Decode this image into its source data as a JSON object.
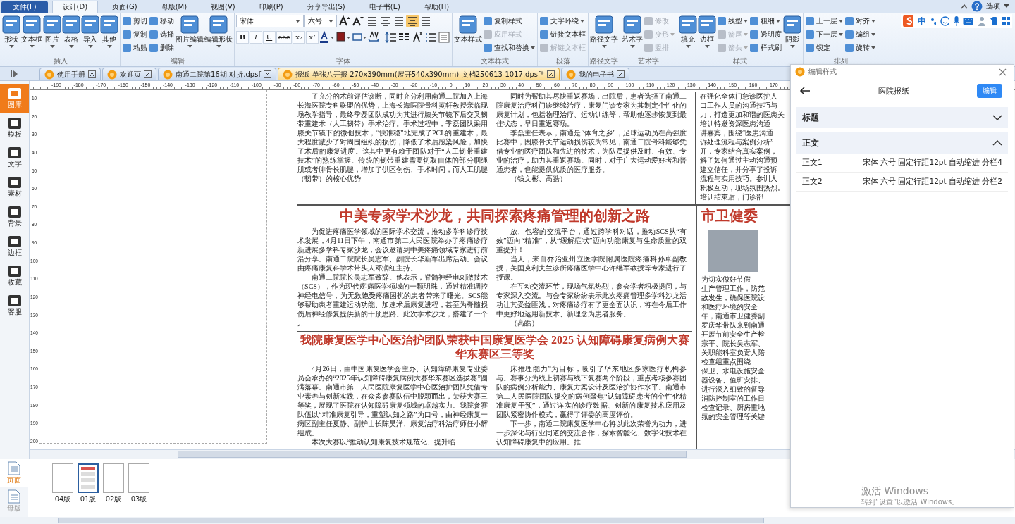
{
  "menu": {
    "tabs": [
      {
        "label": "文件(F)",
        "kind": "file",
        "selected": false
      },
      {
        "label": "设计(D)",
        "kind": "tab",
        "selected": true
      },
      {
        "label": "页面(G)",
        "kind": "tab",
        "selected": false
      },
      {
        "label": "母版(M)",
        "kind": "tab",
        "selected": false
      },
      {
        "label": "视图(V)",
        "kind": "tab",
        "selected": false
      },
      {
        "label": "印刷(P)",
        "kind": "tab",
        "selected": false
      },
      {
        "label": "分享导出(S)",
        "kind": "tab",
        "selected": false
      },
      {
        "label": "电子书(E)",
        "kind": "tab",
        "selected": false
      },
      {
        "label": "帮助(H)",
        "kind": "tab",
        "selected": false
      }
    ],
    "options": "选项"
  },
  "ime": {
    "label": "中"
  },
  "ribbon": {
    "groups": [
      {
        "label": "插入",
        "items": [
          {
            "kind": "large",
            "label": "形状",
            "menu": true
          },
          {
            "kind": "large",
            "label": "文本框",
            "menu": true
          },
          {
            "kind": "large",
            "label": "图片",
            "menu": true
          },
          {
            "kind": "large",
            "label": "表格",
            "menu": true
          },
          {
            "kind": "large",
            "label": "导入",
            "menu": true
          },
          {
            "kind": "large",
            "label": "其他",
            "menu": true
          }
        ]
      },
      {
        "label": "编辑",
        "items": [
          {
            "kind": "stack",
            "items": [
              {
                "label": "剪切",
                "disabled": false,
                "menu": false
              },
              {
                "label": "复制",
                "disabled": false,
                "menu": false
              },
              {
                "label": "粘贴",
                "disabled": false,
                "menu": false
              }
            ]
          },
          {
            "kind": "stack",
            "items": [
              {
                "label": "移动",
                "disabled": false,
                "menu": false
              },
              {
                "label": "选择",
                "disabled": false,
                "menu": false
              },
              {
                "label": "删除",
                "disabled": false,
                "menu": false
              }
            ]
          },
          {
            "kind": "large",
            "label": "图片编辑",
            "menu": true
          },
          {
            "kind": "large",
            "label": "编辑形状",
            "menu": true
          }
        ]
      },
      {
        "label": "字体",
        "items": [
          {
            "kind": "font",
            "font": "宋体",
            "size": "六号",
            "alignment": [
              {
                "selected": false
              },
              {
                "selected": false
              },
              {
                "selected": false
              },
              {
                "selected": true
              },
              {
                "selected": false
              }
            ],
            "text_buttons": [
              "B",
              "I",
              "U",
              "abc",
              "x₂",
              "x²"
            ]
          }
        ]
      },
      {
        "label": "文本样式",
        "items": [
          {
            "kind": "large",
            "label": "文本样式",
            "menu": false
          },
          {
            "kind": "stack",
            "items": [
              {
                "label": "复制样式",
                "disabled": false,
                "menu": false
              },
              {
                "label": "应用样式",
                "disabled": true,
                "menu": false
              },
              {
                "label": "查找和替换",
                "disabled": false,
                "menu": true
              }
            ]
          }
        ]
      },
      {
        "label": "段落",
        "items": [
          {
            "kind": "stack",
            "items": [
              {
                "label": "文字环绕",
                "disabled": false,
                "menu": true
              },
              {
                "label": "链接文本框",
                "disabled": false,
                "menu": false
              },
              {
                "label": "解链文本框",
                "disabled": true,
                "menu": false
              }
            ]
          }
        ]
      },
      {
        "label": "路径文字",
        "items": [
          {
            "kind": "large",
            "label": "路径文字",
            "menu": true
          }
        ]
      },
      {
        "label": "艺术字",
        "items": [
          {
            "kind": "large",
            "label": "艺术字",
            "menu": true
          },
          {
            "kind": "stack",
            "items": [
              {
                "label": "修改",
                "disabled": true,
                "menu": false
              },
              {
                "label": "变形",
                "disabled": true,
                "menu": true
              },
              {
                "label": "竖排",
                "disabled": true,
                "menu": false
              }
            ]
          }
        ]
      },
      {
        "label": "样式",
        "items": [
          {
            "kind": "large",
            "label": "填充",
            "menu": true
          },
          {
            "kind": "large",
            "label": "边框",
            "menu": true
          },
          {
            "kind": "stack",
            "items": [
              {
                "label": "线型",
                "disabled": false,
                "menu": true
              },
              {
                "label": "箭尾",
                "disabled": true,
                "menu": true
              },
              {
                "label": "箭头",
                "disabled": true,
                "menu": true
              }
            ]
          },
          {
            "kind": "stack",
            "items": [
              {
                "label": "粗细",
                "disabled": false,
                "menu": true
              },
              {
                "label": "透明度",
                "disabled": false,
                "menu": false
              },
              {
                "label": "样式刷",
                "disabled": false,
                "menu": false
              }
            ]
          },
          {
            "kind": "large",
            "label": "阴影",
            "menu": true
          }
        ]
      },
      {
        "label": "排列",
        "items": [
          {
            "kind": "stack",
            "items": [
              {
                "label": "上一层",
                "disabled": false,
                "menu": true
              },
              {
                "label": "下一层",
                "disabled": false,
                "menu": true
              },
              {
                "label": "锁定",
                "disabled": false,
                "menu": false
              }
            ]
          },
          {
            "kind": "stack",
            "items": [
              {
                "label": "对齐",
                "disabled": false,
                "menu": true
              },
              {
                "label": "编组",
                "disabled": false,
                "menu": true
              },
              {
                "label": "旋转",
                "disabled": false,
                "menu": true
              }
            ]
          }
        ]
      }
    ]
  },
  "document_tabs": [
    {
      "label": "使用手册",
      "selected": false
    },
    {
      "label": "欢迎页",
      "selected": false
    },
    {
      "label": "南通二院第16期-对折.dpsf",
      "selected": false
    },
    {
      "label": "报纸-单张八开报-270x390mm(展开540x390mm)-文档250613-1017.dpsf*",
      "selected": true
    },
    {
      "label": "我的电子书",
      "selected": false
    }
  ],
  "sidebar": {
    "items": [
      {
        "label": "图库",
        "selected": true
      },
      {
        "label": "模板",
        "selected": false
      },
      {
        "label": "文字",
        "selected": false
      },
      {
        "label": "素材",
        "selected": false
      },
      {
        "label": "背景",
        "selected": false
      },
      {
        "label": "边框",
        "selected": false
      },
      {
        "label": "收藏",
        "selected": false
      },
      {
        "label": "客服",
        "selected": false
      }
    ]
  },
  "ruler": {
    "horizontal": [
      "-190",
      "-180",
      "-170",
      "-160",
      "-150",
      "-140",
      "-130",
      "-120",
      "-110",
      "-100",
      "-90",
      "-80",
      "-70",
      "-60",
      "-50",
      "-40",
      "-30",
      "-20",
      "-10",
      "0",
      "10",
      "20",
      "30",
      "40",
      "50",
      "60",
      "70",
      "80",
      "90",
      "100",
      "110",
      "120",
      "130",
      "140",
      "150",
      "160",
      "170"
    ],
    "vertical": [
      "10",
      "20",
      "30",
      "40",
      "50",
      "60",
      "70",
      "80",
      "90",
      "100",
      "110",
      "120",
      "130",
      "140",
      "150",
      "160",
      "170",
      "180",
      "190",
      "200"
    ]
  },
  "newspaper": {
    "top_columns": [
      {
        "paragraphs": [
          "了充分的术前评估诊断，同时充分利用南通二院加入上海长海医院专科联盟的优势，上海长海医院骨科黄轩教授亲临现场教学指导，最终季磊团队成功为其进行膝关节镜下后交叉韧带重建术（人工韧带）手术治疗。手术过程中，季磊团队采用膝关节镜下的微创技术，“快准稳”地完成了PCL的重建术，最大程度减少了对周围组织的损伤，降低了术后感染风险，加快了术后的康复进度。这其中更有赖于团队对于“人工韧带重建技术”的熟练掌握。传统的韧带重建需要切取自体的部分腘绳肌或者腓骨长肌腱，增加了供区创伤、手术时间，而人工肌腱（韧带）的核心优势"
        ]
      },
      {
        "paragraphs": [
          "同时为帮助其尽快重返赛场，出院后，患者选择了南通二院康复治疗科门诊继续治疗，康复门诊专家为其制定个性化的康复计划，包括物理治疗、运动训练等，帮助他逐步恢复到最佳状态，早日重返赛场。",
          "季磊主任表示，南通是“体育之乡”，足球运动员在高强度比赛中，因膝骨关节运动损伤较为常见，南通二院骨科能够凭借专业的医疗团队和先进的技术，为队员提供及时、有效、专业的治疗，助力其重返赛场。同时，对于广大运动爱好者和普通患者，也能提供优质的医疗服务。",
          "（钱文彬、高皓）"
        ]
      }
    ],
    "top_right_lines": [
      "在强化全体门急诊医护人",
      "口工作人员的沟通技巧与",
      "力，打造更加和谐的医患关",
      "培训特邀资深医患沟通",
      "讲嘉宾，围绕“医患沟通",
      "诉处理流程与案例分析”",
      "开，专家结合真实案例，",
      "解了如何通过主动沟通预",
      "建立信任，并分享了投诉",
      "流程与实用技巧。参训人",
      "积极互动，现场氛围热烈。",
      "培训结束后，门诊部"
    ],
    "articles": [
      {
        "headline": "中美专家学术沙龙，共同探索疼痛管理的创新之路",
        "columns": [
          {
            "paragraphs": [
              "为促进疼痛医学领域的国际学术交流，推动多学科诊疗技术发展，4月11日下午，南通市第二人民医院举办了疼痛诊疗新进展多学科专家沙龙，会议邀请到中美疼痛领域专家进行前沿分享。南通二院院长吴志军、副院长华新军出席活动。会议由疼痛康复科学术带头人邓润红主持。",
              "南通二院院长吴志军致辞。他表示，脊髓神经电刺激技术（SCS），作为现代疼痛医学领域的一颗明珠，通过精准调控神经电信号，为无数饱受疼痛困扰的患者带来了曙光。SCS能够帮助患者重建运动功能、加速术后康复进程，甚至为脊髓损伤后神经修复提供新的干预思路。此次学术沙龙，搭建了一个开"
            ]
          },
          {
            "paragraphs": [
              "放、包容的交流平台，通过跨学科对话，推动SCS从“有效”迈向“精准”，从“缓解症状”迈向功能康复与生命质量的双重提升！",
              "当天，来自乔治亚州立医学院附属医院疼痛科孙卓副教授，美国克利夫兰诊所疼痛医学中心许继军教授等专家进行了授课。",
              "在互动交流环节，现场气氛热烈，参会学者积极提问，与专家深入交流。与会专家纷纷表示此次疼痛管理多学科沙龙活动让其受益匪浅，对疼痛诊疗有了更全面认识，将在今后工作中更好地运用新技术、新理念为患者服务。",
              "（高皓）"
            ]
          }
        ]
      },
      {
        "headline": "我院康复医学中心医治护团队荣获中国康复医学会 2025 认知障碍康复病例大赛华东赛区三等奖",
        "columns": [
          {
            "paragraphs": [
              "4月26日，由中国康复医学会主办、认知障碍康复专业委员会承办的“2025年认知障碍康复病例大赛华东赛区选拔赛”圆满落幕。南通市第二人民医院康复医学中心医治护团队凭借专业素养与创新实践，在众多参赛队伍中脱颖而出，荣获大赛三等奖，展现了医院在认知障碍康复领域的卓越实力。我院参赛队伍以“精准康复引导，重塑认知之路”为口号，由神经康复一病区副主任夏静、副护士长陈昊洋、康复治疗科治疗师任小辉组成。",
              "本次大赛以“推动认知康复技术规范化、提升临"
            ]
          },
          {
            "paragraphs": [
              "床推理能力”为目标，吸引了华东地区多家医疗机构参与。赛事分为线上初赛与线下复赛两个阶段，重点考核参赛团队的病例分析能力、康复方案设计及医治护协作水平。南通市第二人民医院团队提交的病例聚焦“认知障碍患者的个性化精准康复干预”，通过详实的诊疗数据、创新的康复技术应用及团队紧密协作模式，赢得了评委的高度评价。",
              "下一步，南通二院康复医学中心将以此次荣誉为动力，进一步深化与行业同道的交流合作，探索智能化、数字化技术在认知障碍康复中的应用。推"
            ]
          }
        ]
      }
    ],
    "side_article": {
      "headline": "市卫健委",
      "lines": [
        "为切实做好节假",
        "生产管理工作，防范",
        "故发生，确保医院设",
        "和医疗环境的安全",
        "午，南通市卫健委副",
        "罗庆华带队来到南通",
        "开展节前安全生产检",
        "宗平、院长吴志军、",
        "关职能科室负责人陪",
        "检查组重点围绕",
        "保卫、水电设施安全",
        "器设备、值班安排、",
        "进行深入细致的督导",
        "消防控制室的工作日",
        "检查记录、厨房重地",
        "氛的安全管理等关键"
      ]
    }
  },
  "style_panel": {
    "title": "编辑样式",
    "name": "医院报纸",
    "edit_button": "编辑",
    "sections": [
      {
        "label": "标题",
        "expanded": false
      },
      {
        "label": "正文",
        "expanded": true,
        "rows": [
          {
            "name": "正文1",
            "spec": "宋体 六号 固定行距12pt 自动缩进 分栏4"
          },
          {
            "name": "正文2",
            "spec": "宋体 六号 固定行距12pt 自动缩进 分栏2"
          }
        ]
      }
    ]
  },
  "page_panel": {
    "tabs": [
      {
        "label": "页面",
        "selected": true
      },
      {
        "label": "母版",
        "selected": false
      }
    ],
    "pages": [
      {
        "label": "04版",
        "selected": false,
        "blank": true
      },
      {
        "label": "01版",
        "selected": true,
        "blank": false
      },
      {
        "label": "02版",
        "selected": false,
        "blank": true
      },
      {
        "label": "03版",
        "selected": false,
        "blank": true
      }
    ]
  },
  "windows_notice": {
    "title": "激活 Windows",
    "text": "转到“设置”以激活 Windows。"
  }
}
